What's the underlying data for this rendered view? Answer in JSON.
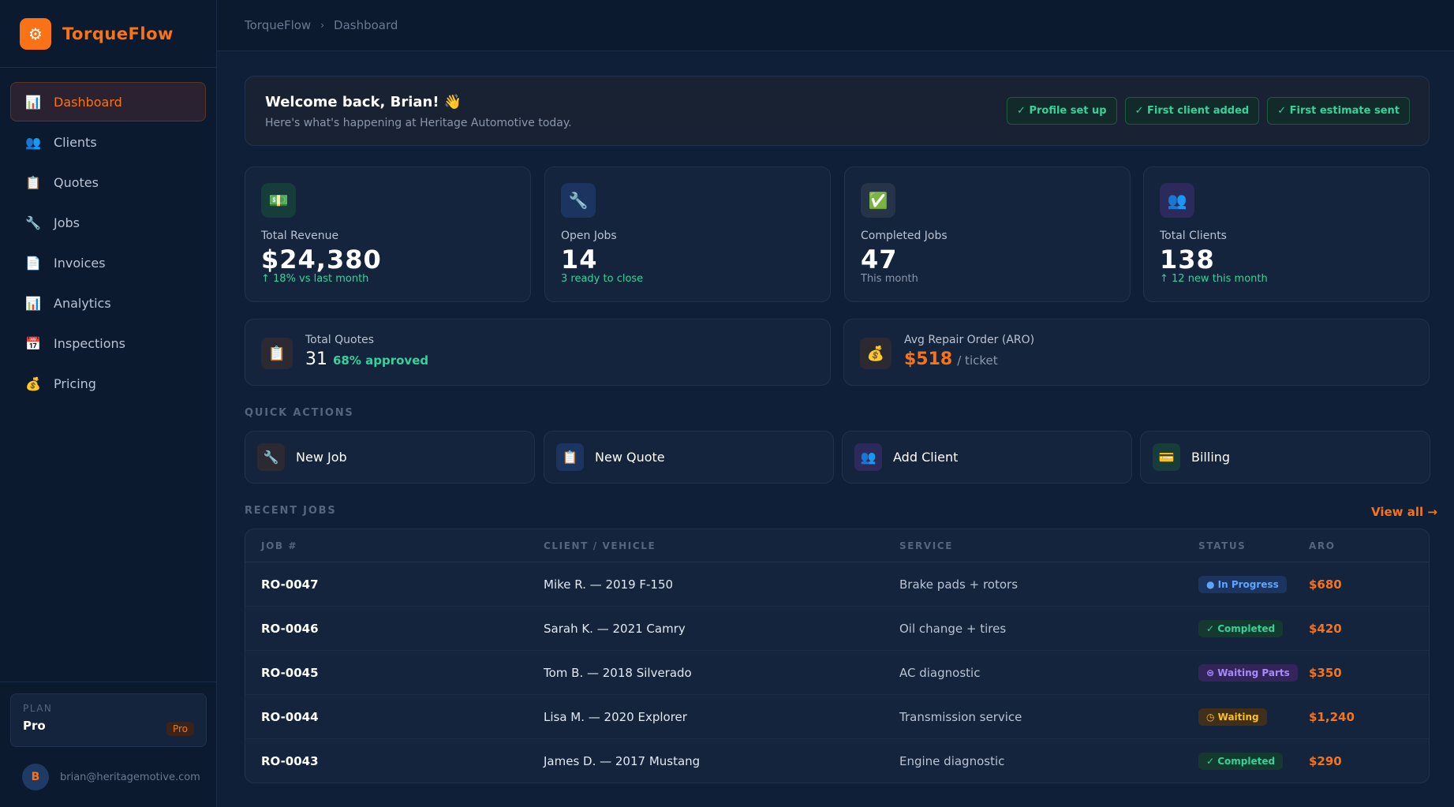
{
  "brand": {
    "name": "TorqueFlow",
    "logo_icon": "⚙"
  },
  "sidebar": {
    "items": [
      {
        "label": "Dashboard",
        "icon": "📊",
        "icon_name": "chart-icon",
        "active": true
      },
      {
        "label": "Clients",
        "icon": "👥",
        "icon_name": "users-icon"
      },
      {
        "label": "Quotes",
        "icon": "📋",
        "icon_name": "clipboard-icon"
      },
      {
        "label": "Jobs",
        "icon": "🔧",
        "icon_name": "wrench-icon"
      },
      {
        "label": "Invoices",
        "icon": "📄",
        "icon_name": "document-icon"
      },
      {
        "label": "Analytics",
        "icon": "📊",
        "icon_name": "analytics-icon"
      },
      {
        "label": "Inspections",
        "icon": "📅",
        "icon_name": "calendar-icon"
      },
      {
        "label": "Pricing",
        "icon": "💰",
        "icon_name": "money-bag-icon"
      }
    ],
    "plan": {
      "label": "PLAN",
      "name": "Pro",
      "badge": "Pro"
    },
    "user": {
      "initial": "B",
      "email": "brian@heritagemotive.com"
    }
  },
  "breadcrumb": {
    "root": "TorqueFlow",
    "sep": "›",
    "current": "Dashboard"
  },
  "welcome": {
    "title": "Welcome back, Brian! 👋",
    "subtitle": "Here's what's happening at Heritage Automotive today.",
    "chips": [
      "✓ Profile set up",
      "✓ First client added",
      "✓ First estimate sent"
    ]
  },
  "stats": [
    {
      "icon": "💵",
      "label": "Total Revenue",
      "value": "$24,380",
      "foot": "↑ 18% vs last month"
    },
    {
      "icon": "🔧",
      "label": "Open Jobs",
      "value": "14",
      "foot": "3 ready to close"
    },
    {
      "icon": "✅",
      "label": "Completed Jobs",
      "value": "47",
      "foot": "This month"
    },
    {
      "icon": "👥",
      "label": "Total Clients",
      "value": "138",
      "foot": "↑ 12 new this month"
    }
  ],
  "quotes_card": {
    "icon": "📋",
    "label": "Total Quotes",
    "value": "31",
    "sub": "68% approved"
  },
  "aro_card": {
    "icon": "💰",
    "label": "Avg Repair Order (ARO)",
    "value": "$518",
    "sub": "/ ticket"
  },
  "quick_actions": {
    "title": "QUICK ACTIONS",
    "items": [
      {
        "icon": "🔧",
        "label": "New Job"
      },
      {
        "icon": "📋",
        "label": "New Quote"
      },
      {
        "icon": "👥",
        "label": "Add Client"
      },
      {
        "icon": "💳",
        "label": "Billing"
      }
    ]
  },
  "recent_jobs": {
    "title": "RECENT JOBS",
    "view_all": "View all →",
    "headers": [
      "JOB #",
      "CLIENT / VEHICLE",
      "SERVICE",
      "STATUS",
      "ARO"
    ],
    "rows": [
      {
        "job": "RO-0047",
        "client": "Mike R. — 2019 F-150",
        "service": "Brake pads + rotors",
        "status": "● In Progress",
        "aro": "$680"
      },
      {
        "job": "RO-0046",
        "client": "Sarah K. — 2021 Camry",
        "service": "Oil change + tires",
        "status": "✓ Completed",
        "aro": "$420"
      },
      {
        "job": "RO-0045",
        "client": "Tom B. — 2018 Silverado",
        "service": "AC diagnostic",
        "status": "⊜ Waiting Parts",
        "aro": "$350"
      },
      {
        "job": "RO-0044",
        "client": "Lisa M. — 2020 Explorer",
        "service": "Transmission service",
        "status": "◷ Waiting",
        "aro": "$1,240"
      },
      {
        "job": "RO-0043",
        "client": "James D. — 2017 Mustang",
        "service": "Engine diagnostic",
        "status": "✓ Completed",
        "aro": "$290"
      }
    ]
  },
  "colors": {
    "accent": "#f97316",
    "green": "#34d399",
    "blue": "#60a5fa",
    "purple": "#a78bfa",
    "amber": "#fbbf24"
  }
}
